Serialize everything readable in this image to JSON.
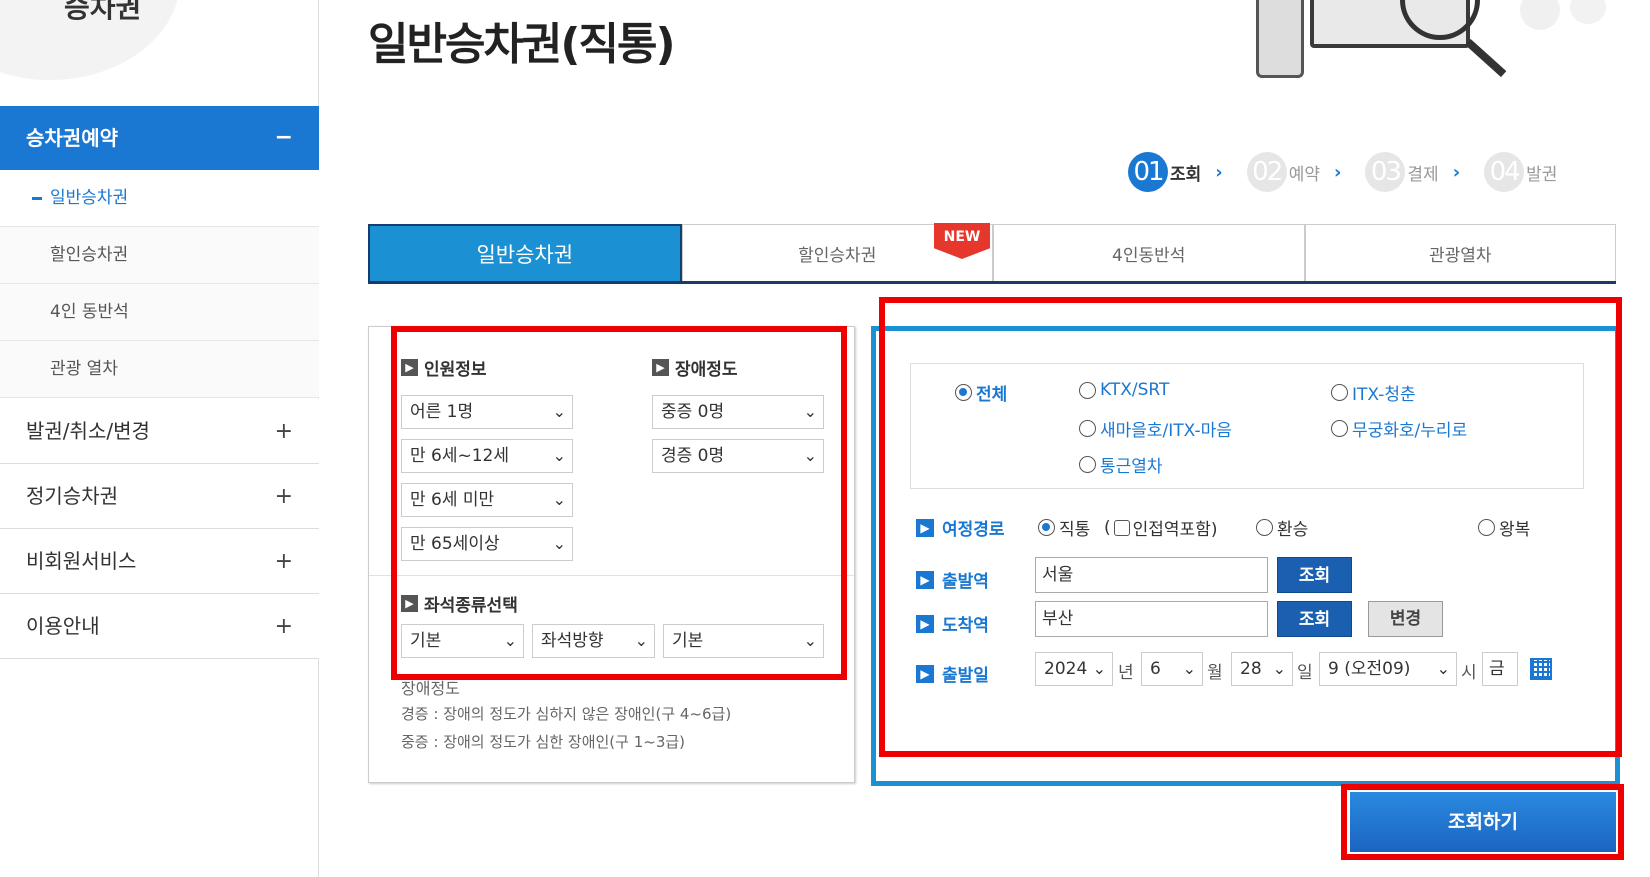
{
  "sidebar": {
    "logo_text": "승차권",
    "header": {
      "label": "승차권예약",
      "toggle": "−"
    },
    "sub_items": [
      {
        "label": "일반승차권"
      },
      {
        "label": "할인승차권"
      },
      {
        "label": "4인 동반석"
      },
      {
        "label": "관광 열차"
      }
    ],
    "main_items": [
      {
        "label": "발권/취소/변경",
        "toggle": "+"
      },
      {
        "label": "정기승차권",
        "toggle": "+"
      },
      {
        "label": "비회원서비스",
        "toggle": "+"
      },
      {
        "label": "이용안내",
        "toggle": "+"
      }
    ]
  },
  "page": {
    "title": "일반승차권(직통)"
  },
  "steps": [
    {
      "num": "01",
      "label": "조회",
      "arrow": "›"
    },
    {
      "num": "02",
      "label": "예약",
      "arrow": "›"
    },
    {
      "num": "03",
      "label": "결제",
      "arrow": "›"
    },
    {
      "num": "04",
      "label": "발권"
    }
  ],
  "tabs": [
    {
      "label": "일반승차권"
    },
    {
      "label": "할인승차권",
      "badge": "NEW"
    },
    {
      "label": "4인동반석"
    },
    {
      "label": "관광열차"
    }
  ],
  "passengers": {
    "title": "인원정보",
    "selects": [
      "어른 1명",
      "만 6세~12세",
      "만 6세 미만",
      "만 65세이상"
    ]
  },
  "disability": {
    "title": "장애정도",
    "selects": [
      "중증 0명",
      "경증 0명"
    ]
  },
  "seat": {
    "title": "좌석종류선택",
    "selects": [
      "기본",
      "좌석방향",
      "기본"
    ]
  },
  "notes": {
    "heading": "장애정도",
    "lines": [
      "경증 : 장애의 정도가 심하지 않은 장애인(구 4~6급)",
      "중증 : 장애의 정도가 심한 장애인(구 1~3급)"
    ]
  },
  "train_types": [
    {
      "label": "전체"
    },
    {
      "label": "KTX/SRT"
    },
    {
      "label": "ITX-청춘"
    },
    {
      "label": "새마을호/ITX-마음"
    },
    {
      "label": "무궁화호/누리로"
    },
    {
      "label": "통근열차"
    }
  ],
  "route": {
    "label": "여정경로",
    "direct": "직통",
    "adjacent": "(",
    "adjacent_label": "인접역포함)",
    "transfer": "환승",
    "roundtrip": "왕복"
  },
  "departure": {
    "label": "출발역",
    "value": "서울",
    "button": "조회"
  },
  "arrival": {
    "label": "도착역",
    "value": "부산",
    "button": "조회",
    "change": "변경"
  },
  "date": {
    "label": "출발일",
    "year": "2024",
    "year_unit": "년",
    "month": "6",
    "month_unit": "월",
    "day": "28",
    "day_unit": "일",
    "hour": "9 (오전09)",
    "hour_unit": "시",
    "weekday": "금"
  },
  "search_button": "조회하기",
  "colors": {
    "accent": "#1b78d2",
    "tab_active": "#1b90d2",
    "highlight": "#ee0000"
  }
}
